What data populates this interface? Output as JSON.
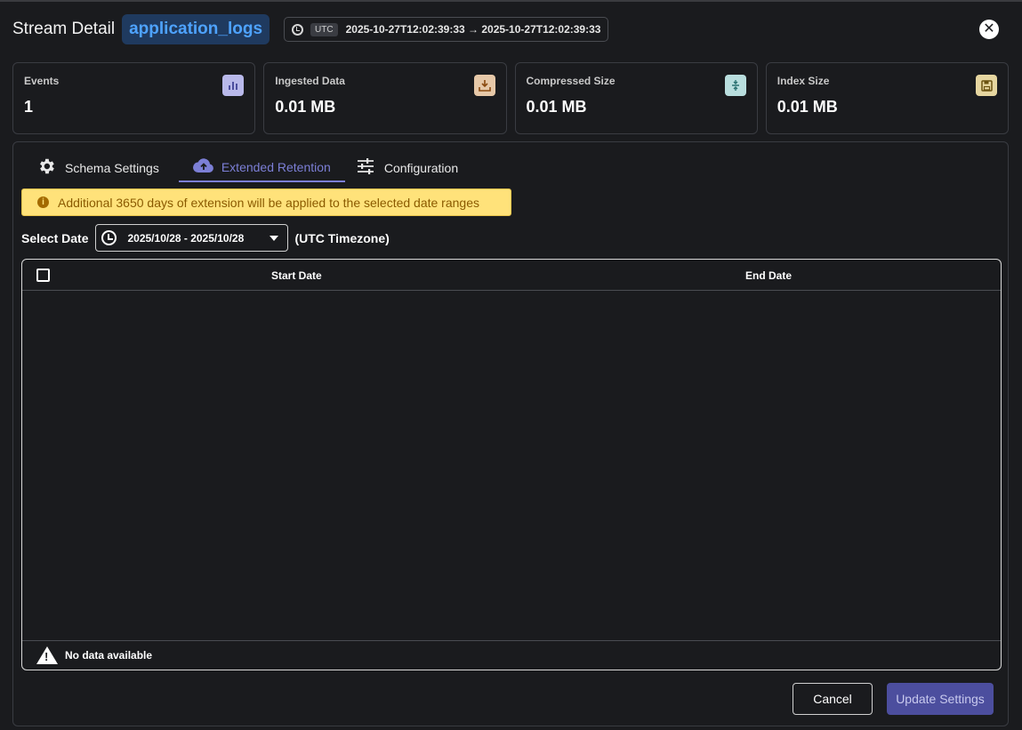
{
  "header": {
    "title": "Stream Detail",
    "stream_name": "application_logs",
    "timezone_chip": "UTC",
    "time_range": "2025-10-27T12:02:39:33 → 2025-10-27T12:02:39:33",
    "close_icon": "close-icon"
  },
  "stats": [
    {
      "label": "Events",
      "value": "1",
      "icon": "bar-chart-icon",
      "icon_bg": "#b9b9ea",
      "icon_color": "#4c4e9e"
    },
    {
      "label": "Ingested Data",
      "value": "0.01 MB",
      "icon": "download-tray-icon",
      "icon_bg": "#e6c8a8",
      "icon_color": "#8a4a10"
    },
    {
      "label": "Compressed Size",
      "value": "0.01 MB",
      "icon": "compress-icon",
      "icon_bg": "#b9dede",
      "icon_color": "#2a7070"
    },
    {
      "label": "Index Size",
      "value": "0.01 MB",
      "icon": "save-icon",
      "icon_bg": "#e6d6a0",
      "icon_color": "#6a5210"
    }
  ],
  "tabs": [
    {
      "label": "Schema Settings",
      "icon": "gear-icon",
      "active": false
    },
    {
      "label": "Extended Retention",
      "icon": "cloud-upload-icon",
      "active": true
    },
    {
      "label": "Configuration",
      "icon": "sliders-icon",
      "active": false
    }
  ],
  "alert": {
    "text": "Additional 3650 days of extension will be applied to the selected date ranges"
  },
  "date_filter": {
    "label": "Select Date",
    "value": "2025/10/28 - 2025/10/28",
    "timezone_note": "(UTC Timezone)"
  },
  "table": {
    "columns": [
      "Start Date",
      "End Date"
    ],
    "rows": [],
    "empty_text": "No data available"
  },
  "actions": {
    "cancel": "Cancel",
    "update": "Update Settings"
  },
  "colors": {
    "accent": "#7c7fd6",
    "stream_badge_bg": "#1f3a5f",
    "stream_badge_text": "#4ea3ff",
    "alert_bg": "#ffe27a",
    "update_button_bg": "#4c4e9e"
  }
}
